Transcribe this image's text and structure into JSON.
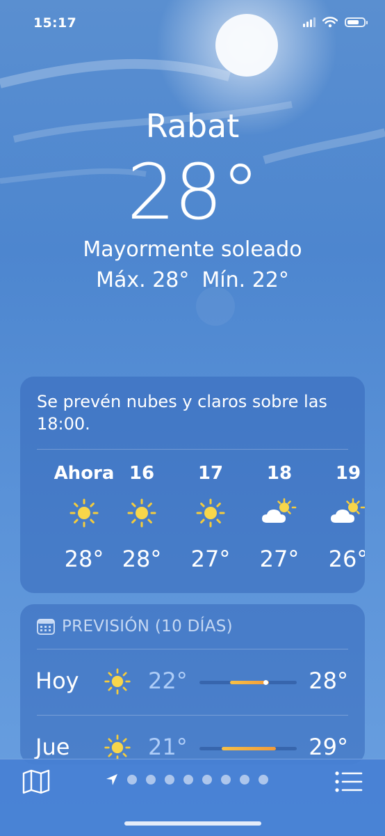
{
  "status_bar": {
    "time": "15:17"
  },
  "location": {
    "city": "Rabat",
    "temperature": "28°",
    "condition": "Mayormente soleado",
    "high": "Máx. 28°",
    "low": "Mín. 22°"
  },
  "hourly": {
    "summary": "Se prevén nubes y claros sobre las 18:00.",
    "items": [
      {
        "time": "Ahora",
        "icon": "sun-icon",
        "temp": "28°"
      },
      {
        "time": "16",
        "icon": "sun-icon",
        "temp": "28°"
      },
      {
        "time": "17",
        "icon": "sun-icon",
        "temp": "27°"
      },
      {
        "time": "18",
        "icon": "partly-cloudy-icon",
        "temp": "27°"
      },
      {
        "time": "19",
        "icon": "partly-cloudy-icon",
        "temp": "26°"
      }
    ]
  },
  "forecast": {
    "title": "PREVISIÓN (10 DÍAS)",
    "days": [
      {
        "day": "Hoy",
        "icon": "sun-icon",
        "low": "22°",
        "high": "28°"
      },
      {
        "day": "Jue",
        "icon": "sun-icon",
        "low": "21°",
        "high": "29°"
      }
    ]
  },
  "colors": {
    "bar_start": "#f7c046",
    "bar_end": "#f29b3a",
    "card": "#3468b9"
  }
}
